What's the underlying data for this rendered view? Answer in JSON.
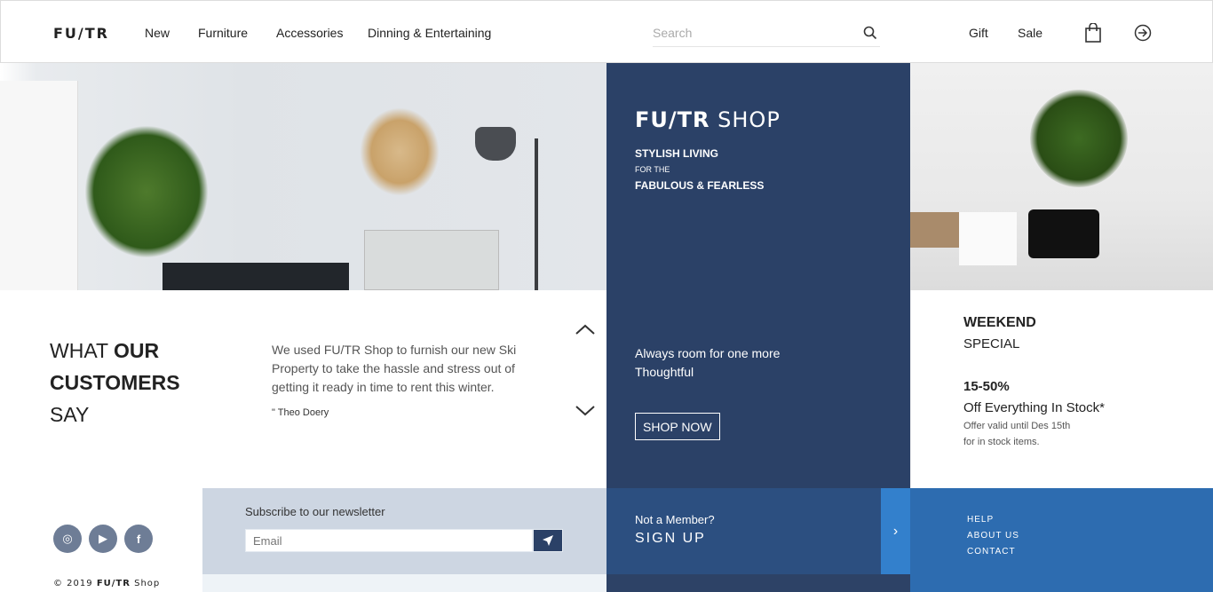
{
  "header": {
    "logo": "FU/TR",
    "nav": [
      "New",
      "Furniture",
      "Accessories",
      "Dinning & Entertaining"
    ],
    "search_placeholder": "Search",
    "right_links": [
      "Gift",
      "Sale"
    ]
  },
  "hero": {
    "title_bold": "FU/TR",
    "title_light": "SHOP",
    "line1": "STYLISH LIVING",
    "line2": "FOR THE",
    "line3": "FABULOUS & FEARLESS",
    "tagline1": "Always room for one more",
    "tagline2": "Thoughtful",
    "cta": "SHOP NOW"
  },
  "testimonial": {
    "h1": "WHAT ",
    "h1b": "OUR",
    "h2": "CUSTOMERS",
    "h3": "SAY",
    "quote": "We used FU/TR Shop to furnish our new Ski Property to take the hassle and stress out of getting it ready in time to rent this winter.",
    "author": "Theo Doery",
    "quote_mark": "\""
  },
  "weekend": {
    "title": "WEEKEND",
    "subtitle": "SPECIAL",
    "discount": "15-50%",
    "offer": "Off Everything In Stock*",
    "note1": "Offer valid until Des 15th",
    "note2": "for in stock items."
  },
  "footer": {
    "newsletter_label": "Subscribe to our newsletter",
    "email_placeholder": "Email",
    "copyright_pre": "© 2019 ",
    "copyright_bold": "FU/TR",
    "copyright_post": " Shop",
    "member_q": "Not a Member?",
    "signup": "SIGN UP",
    "links": [
      "HELP",
      "ABOUT US",
      "CONTACT"
    ]
  },
  "colors": {
    "navy": "#2b4167",
    "signup": "#2c4f80",
    "accent": "#3380cc",
    "footer_blue": "#2d6cb0",
    "newsletter_bg": "#cdd6e2"
  }
}
